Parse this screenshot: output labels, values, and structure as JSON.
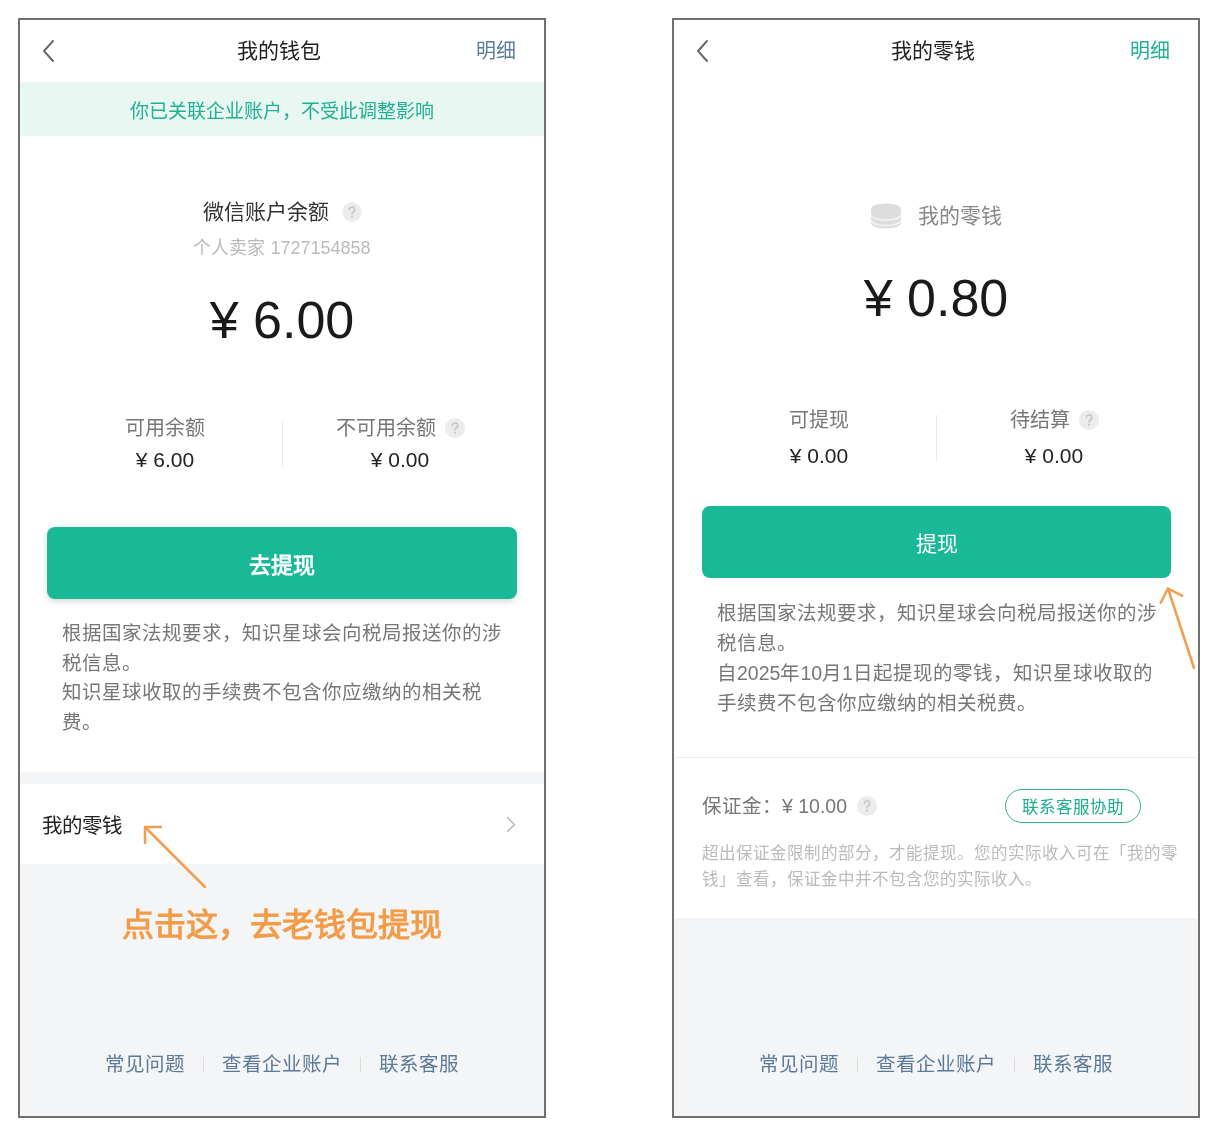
{
  "wallet_screen": {
    "header": {
      "title": "我的钱包",
      "action": "明细"
    },
    "notice_banner": "你已关联企业账户，不受此调整影响",
    "balance": {
      "label": "微信账户余额",
      "help": true,
      "account": "个人卖家 1727154858",
      "amount": "¥ 6.00"
    },
    "breakdown": [
      {
        "label": "可用余额",
        "value": "¥ 6.00",
        "help": false
      },
      {
        "label": "不可用余额",
        "value": "¥ 0.00",
        "help": true
      }
    ],
    "primary_button": "去提现",
    "tax_notice": [
      "根据国家法规要求，知识星球会向税局报送你的涉税信息。",
      "知识星球收取的手续费不包含你应缴纳的相关税费。"
    ],
    "menu_item": "我的零钱",
    "annotation": "点击这，去老钱包提现",
    "footer_links": [
      "常见问题",
      "查看企业账户",
      "联系客服"
    ]
  },
  "change_screen": {
    "header": {
      "title": "我的零钱",
      "action": "明细"
    },
    "balance": {
      "label": "我的零钱",
      "amount": "¥ 0.80"
    },
    "breakdown": [
      {
        "label": "可提现",
        "value": "¥ 0.00",
        "help": false
      },
      {
        "label": "待结算",
        "value": "¥ 0.00",
        "help": true
      }
    ],
    "primary_button": "提现",
    "tax_notice": [
      "根据国家法规要求，知识星球会向税局报送你的涉税信息。",
      "自2025年10月1日起提现的零钱，知识星球收取的手续费不包含你应缴纳的相关税费。"
    ],
    "deposit": {
      "label": "保证金：¥ 10.00",
      "help": true,
      "button": "联系客服协助",
      "note": "超出保证金限制的部分，才能提现。您的实际收入可在「我的零钱」查看，保证金中并不包含您的实际收入。"
    },
    "footer_links": [
      "常见问题",
      "查看企业账户",
      "联系客服"
    ]
  }
}
